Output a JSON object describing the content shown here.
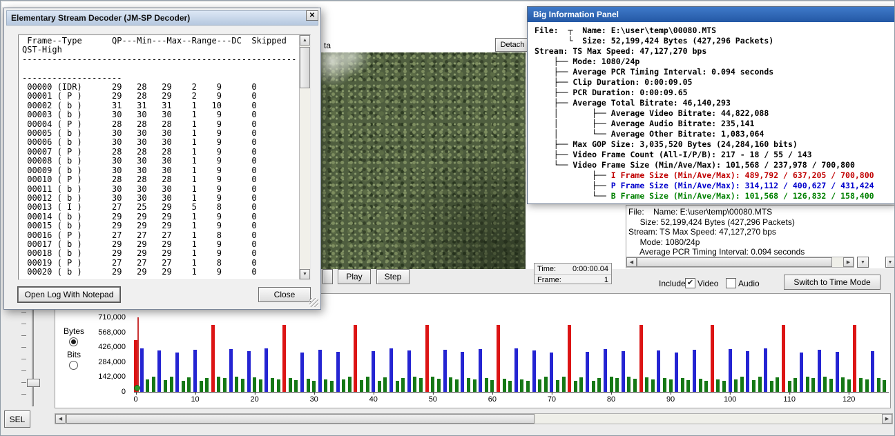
{
  "icons": {
    "close": "✕",
    "scroll_up": "▲",
    "scroll_down": "▼",
    "scroll_left": "◀",
    "scroll_right": "▶",
    "dropdown": "▼",
    "check": "✔"
  },
  "decoder_window": {
    "title": "Elementary Stream Decoder (JM-SP Decoder)",
    "open_log_button": "Open Log With Notepad",
    "close_button": "Close",
    "log_lines": [
      " Frame--Type      QP---Min---Max--Range---DC  Skipped",
      "QST-High",
      "-------------------------------------------------------",
      "",
      "--------------------",
      " 00000 (IDR)      29   28   29    2    9      0",
      " 00001 ( P )      29   28   29    2    9      0",
      " 00002 ( b )      31   31   31    1   10      0",
      " 00003 ( b )      30   30   30    1    9      0",
      " 00004 ( P )      28   28   28    1    9      0",
      " 00005 ( b )      30   30   30    1    9      0",
      " 00006 ( b )      30   30   30    1    9      0",
      " 00007 ( P )      28   28   28    1    9      0",
      " 00008 ( b )      30   30   30    1    9      0",
      " 00009 ( b )      30   30   30    1    9      0",
      " 00010 ( P )      28   28   28    1    9      0",
      " 00011 ( b )      30   30   30    1    9      0",
      " 00012 ( b )      30   30   30    1    9      0",
      " 00013 ( I )      27   25   29    5    8      0",
      " 00014 ( b )      29   29   29    1    9      0",
      " 00015 ( b )      29   29   29    1    9      0",
      " 00016 ( P )      27   27   27    1    8      0",
      " 00017 ( b )      29   29   29    1    9      0",
      " 00018 ( b )      29   29   29    1    9      0",
      " 00019 ( P )      27   27   27    1    8      0",
      " 00020 ( b )      29   29   29    1    9      0"
    ]
  },
  "info_panel": {
    "title": "Big Information Panel",
    "lines": [
      {
        "pre": "",
        "text": "File:  ┬  Name: E:\\user\\temp\\00080.MTS"
      },
      {
        "pre": "",
        "text": "       └  Size: 52,199,424 Bytes (427,296 Packets)"
      },
      {
        "pre": "",
        "text": "Stream: TS Max Speed: 47,127,270 bps"
      },
      {
        "pre": "",
        "text": "    ├── Mode: 1080/24p"
      },
      {
        "pre": "",
        "text": "    ├── Average PCR Timing Interval: 0.094 seconds"
      },
      {
        "pre": "",
        "text": "    ├── Clip Duration: 0:00:09.05"
      },
      {
        "pre": "",
        "text": "    ├── PCR Duration: 0:00:09.65"
      },
      {
        "pre": "",
        "text": "    ├── Average Total Bitrate: 46,140,293"
      },
      {
        "pre": "",
        "text": "    │       ├── Average Video Bitrate: 44,822,088"
      },
      {
        "pre": "",
        "text": "    │       ├── Average Audio Bitrate: 235,141"
      },
      {
        "pre": "",
        "text": "    │       └── Average Other Bitrate: 1,083,064"
      },
      {
        "pre": "",
        "text": "    ├── Max GOP Size: 3,035,520 Bytes (24,284,160 bits)"
      },
      {
        "pre": "",
        "text": "    ├── Video Frame Count (All-I/P/B): 217 - 18 / 55 / 143"
      },
      {
        "pre": "",
        "text": "    └── Video Frame Size (Min/Ave/Max): 101,568 / 237,978 / 700,800"
      },
      {
        "pre": "            ├── ",
        "text": "I Frame Size (Min/Ave/Max): 489,792 / 637,205 / 700,800",
        "color": "#c00000"
      },
      {
        "pre": "            ├── ",
        "text": "P Frame Size (Min/Ave/Max): 314,112 / 400,627 / 431,424",
        "color": "#0000cc"
      },
      {
        "pre": "            └── ",
        "text": "B Frame Size (Min/Ave/Max): 101,568 / 126,832 / 158,400",
        "color": "#008000"
      }
    ]
  },
  "media": {
    "partial_tab_label": "ta",
    "detach_button": "Detach",
    "play_button": "Play",
    "step_button": "Step",
    "time_label": "Time:",
    "time_value": "0:00:00.04",
    "frame_label": "Frame:",
    "frame_value": "1"
  },
  "sub_info": {
    "lines": [
      "File:    Name: E:\\user\\temp\\00080.MTS",
      "     Size: 52,199,424 Bytes (427,296 Packets)",
      "Stream: TS Max Speed: 47,127,270 bps",
      "     Mode: 1080/24p",
      "     Average PCR Timing Interval: 0.094 seconds"
    ]
  },
  "controls": {
    "include_label": "Include:",
    "video_label": "Video",
    "video_checked": true,
    "audio_label": "Audio",
    "audio_checked": false,
    "switch_button": "Switch to Time Mode",
    "bytes_label": "Bytes",
    "bits_label": "Bits",
    "sel_button": "SEL"
  },
  "chart_data": {
    "type": "bar",
    "unit": "Bytes",
    "ylim": [
      0,
      710000
    ],
    "yticks": [
      710000,
      568000,
      426000,
      284000,
      142000,
      0
    ],
    "ytick_labels": [
      "710,000",
      "568,000",
      "426,000",
      "284,000",
      "142,000",
      "0"
    ],
    "xticks": [
      0,
      10,
      20,
      30,
      40,
      50,
      60,
      70,
      80,
      90,
      100,
      110,
      120
    ],
    "frame_count": 127,
    "frame_type_sequence": "IPbbPbbPbbPbbIbbPbbPbbPbbIbbPbbPbbPbbIbbPbbPbbPbbIbbPbbPbbPbbIbbPbbPbbPbbIbbPbbPbbPbbIbbPbbPbbPbbIbbPbbPbbPbbIbbPbbPbbPbbIbbPbb",
    "sizes_by_type": {
      "I": 637205,
      "P": 400627,
      "b": 126832
    },
    "first_frame_size": 489792,
    "colors": {
      "I": "#dc1414",
      "P": "#2424d2",
      "b": "#157815"
    },
    "cursor_frame": 0
  }
}
